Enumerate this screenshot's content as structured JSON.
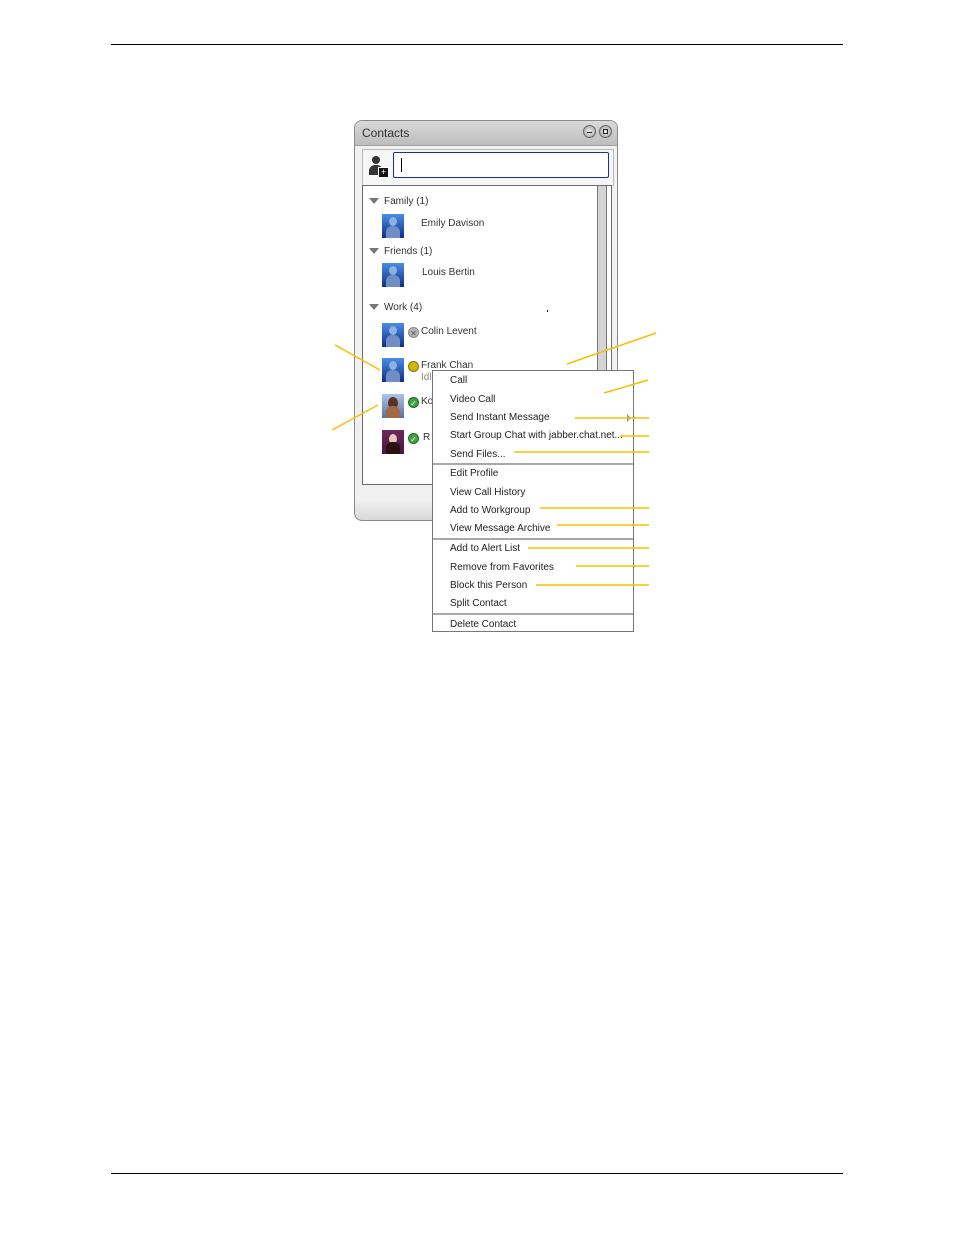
{
  "window": {
    "title": "Contacts",
    "minimize_label": "minimize",
    "popout_label": "pop-out",
    "search": {
      "value": "",
      "placeholder": ""
    }
  },
  "groups": [
    {
      "label": "Family (1)",
      "contacts": [
        {
          "name": "Emily Davison",
          "status": "none",
          "avatar": "default"
        }
      ]
    },
    {
      "label": "Friends (1)",
      "contacts": [
        {
          "name": "Louis Bertin",
          "status": "none",
          "avatar": "default"
        }
      ]
    },
    {
      "label": "Work (4)",
      "contacts": [
        {
          "name": "Colin Levent",
          "status": "offline",
          "avatar": "default"
        },
        {
          "name": "Frank Chan",
          "sub": "Idl",
          "status": "idle",
          "avatar": "default"
        },
        {
          "name": "Ko",
          "status": "online",
          "avatar": "photo"
        },
        {
          "name": "R",
          "status": "online",
          "avatar": "photo"
        }
      ]
    }
  ],
  "context_menu": {
    "sections": [
      [
        "Call",
        "Video Call",
        "Send Instant Message",
        "Start Group Chat with jabber.chat.net...",
        "Send Files..."
      ],
      [
        "Edit Profile",
        "View Call History",
        "Add to Workgroup",
        "View Message Archive"
      ],
      [
        "Add to Alert List",
        "Remove from Favorites",
        "Block this Person",
        "Split Contact"
      ],
      [
        "Delete Contact"
      ]
    ],
    "submenu_item": "Send Instant Message"
  },
  "colors": {
    "callout": "#f5c000",
    "search_border": "#1a2f9a",
    "status_online": "#3da33d",
    "status_idle": "#d1b50a",
    "status_offline": "#b5b5b5"
  }
}
